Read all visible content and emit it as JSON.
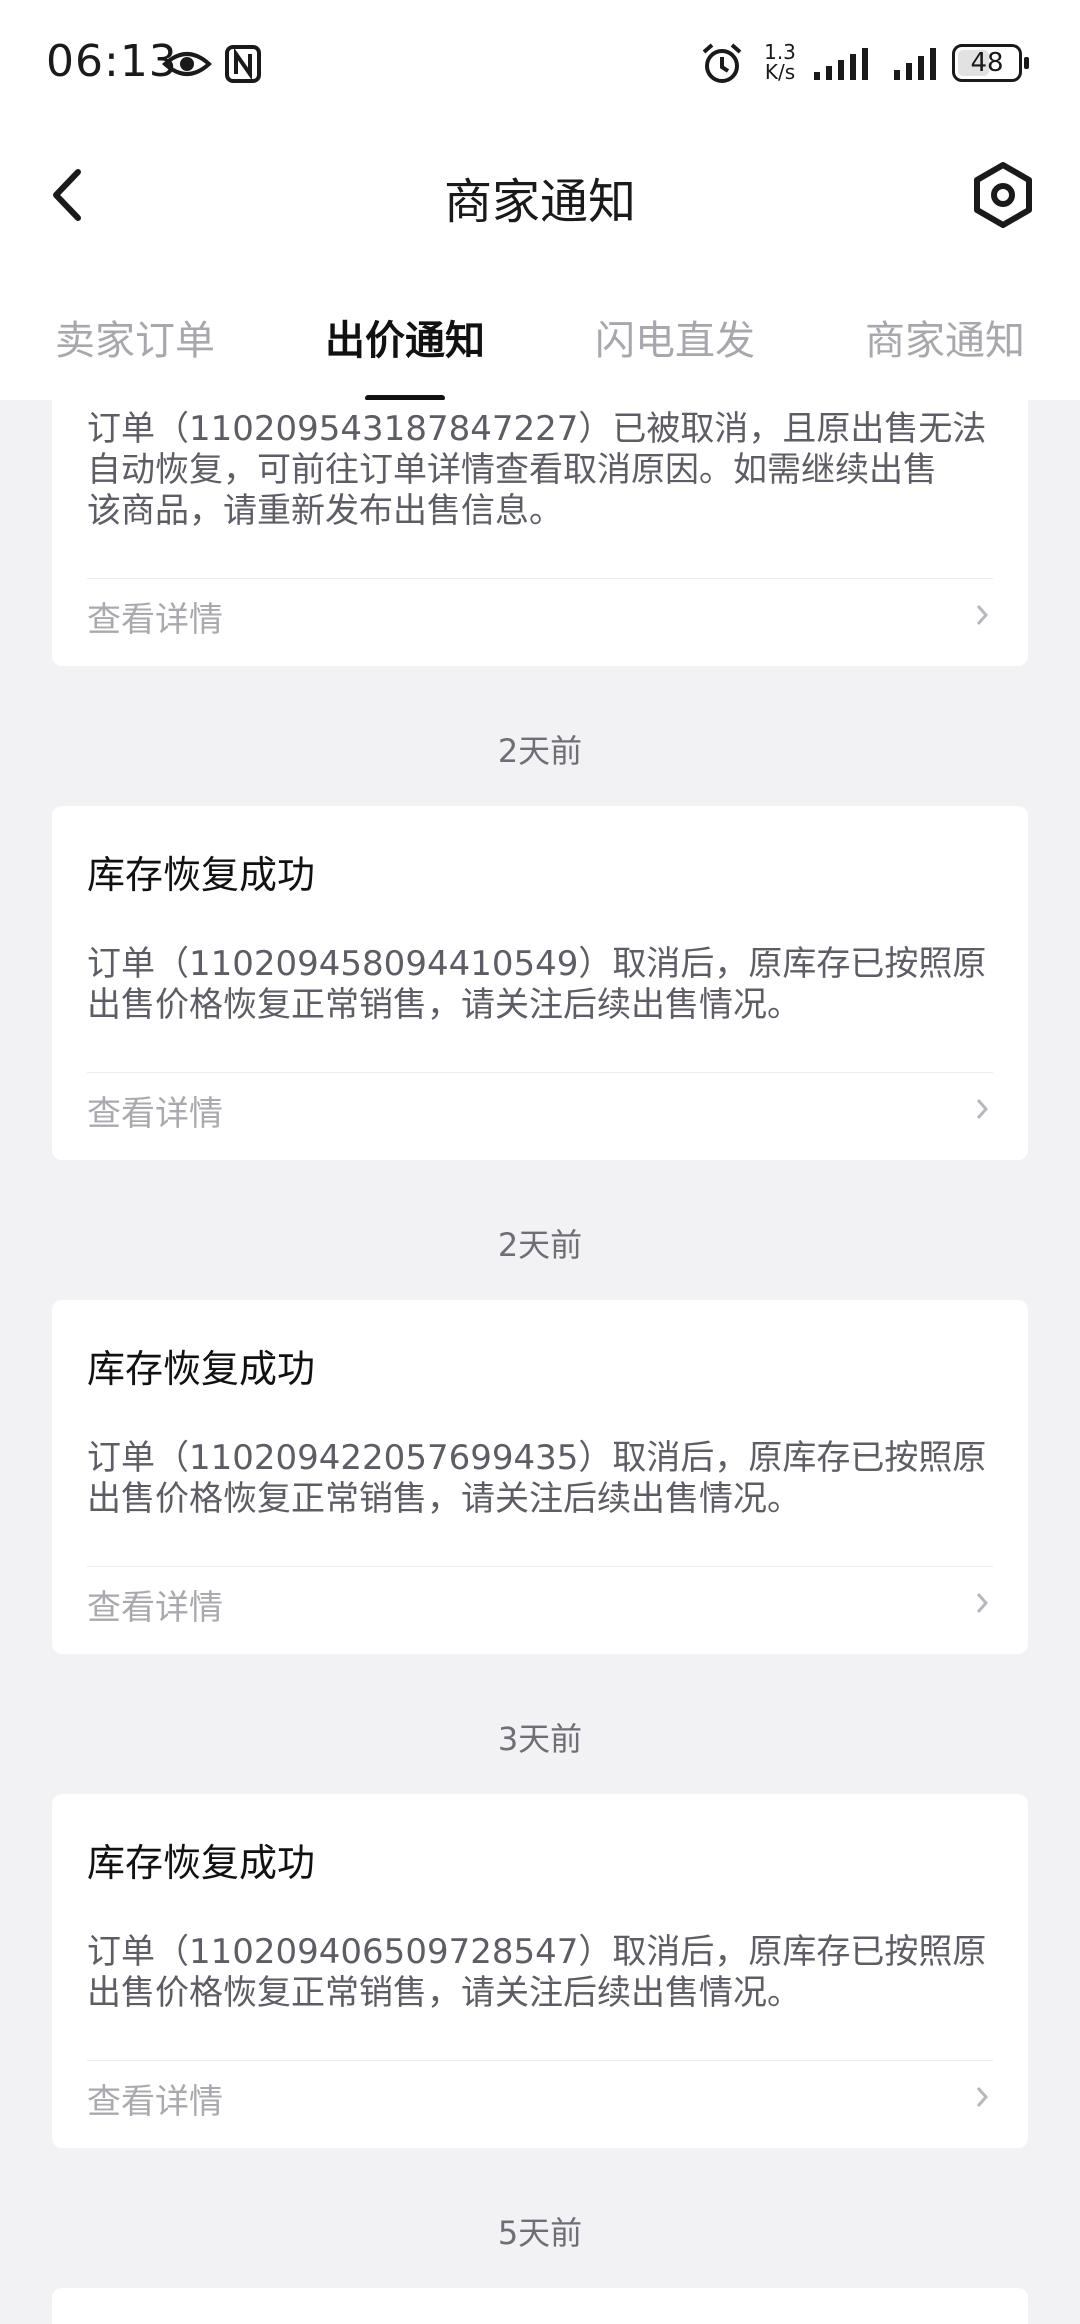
{
  "status_bar": {
    "time": "06:13",
    "net_speed_value": "1.3",
    "net_speed_unit": "K/s",
    "battery": "48"
  },
  "header": {
    "title": "商家通知"
  },
  "tabs": [
    {
      "label": "卖家订单"
    },
    {
      "label": "出价通知"
    },
    {
      "label": "闪电直发"
    },
    {
      "label": "商家通知"
    }
  ],
  "active_tab": "出价通知",
  "notifications": [
    {
      "body_line1": "订单（110209543187847227）已被取消，且原出售无法",
      "body_line2": "自动恢复，可前往订单详情查看取消原因。如需继续出售",
      "body_line3": "该商品，请重新发布出售信息。",
      "link": "查看详情"
    },
    {
      "time": "2天前",
      "title": "库存恢复成功",
      "body_line1": "订单（110209458094410549）取消后，原库存已按照原",
      "body_line2": "出售价格恢复正常销售，请关注后续出售情况。",
      "link": "查看详情"
    },
    {
      "time": "2天前",
      "title": "库存恢复成功",
      "body_line1": "订单（110209422057699435）取消后，原库存已按照原",
      "body_line2": "出售价格恢复正常销售，请关注后续出售情况。",
      "link": "查看详情"
    },
    {
      "time": "3天前",
      "title": "库存恢复成功",
      "body_line1": "订单（110209406509728547）取消后，原库存已按照原",
      "body_line2": "出售价格恢复正常销售，请关注后续出售情况。",
      "link": "查看详情"
    },
    {
      "time": "5天前"
    }
  ],
  "colors": {
    "background": "#f2f2f5",
    "card": "#ffffff",
    "title_text": "#111111",
    "body_text": "#5d5d66",
    "muted_text": "#a9a9b0",
    "inactive_tab": "#a7a7ad"
  },
  "icons": [
    "eye-icon",
    "nfc-icon",
    "alarm-icon",
    "signal-icon",
    "battery-icon",
    "back-arrow-icon",
    "settings-hexagon-icon",
    "chevron-right-icon"
  ]
}
